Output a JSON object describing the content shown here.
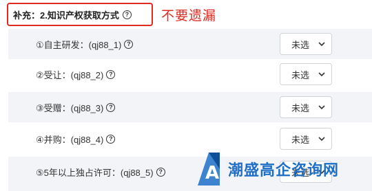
{
  "header": {
    "title": "补充：2.知识产权获取方式",
    "help_icon": "question-circle-icon"
  },
  "annotation": "不要遗漏",
  "rows": [
    {
      "label": "①自主研发：(qj88_1)",
      "select_value": "未选"
    },
    {
      "label": "②受让：(qj88_2)",
      "select_value": "未选"
    },
    {
      "label": "③受赠：(qj88_3)",
      "select_value": "未选"
    },
    {
      "label": "④并购：(qj88_4)",
      "select_value": "未选"
    },
    {
      "label": "⑤5年以上独占许可：(qj88_5)",
      "select_value": "未选"
    }
  ],
  "watermark": {
    "text": "潮盛高企咨询网"
  },
  "colors": {
    "accent_red": "#e02a20",
    "watermark_blue": "#1f6fc8",
    "row_stripe": "#f2f4f8"
  }
}
